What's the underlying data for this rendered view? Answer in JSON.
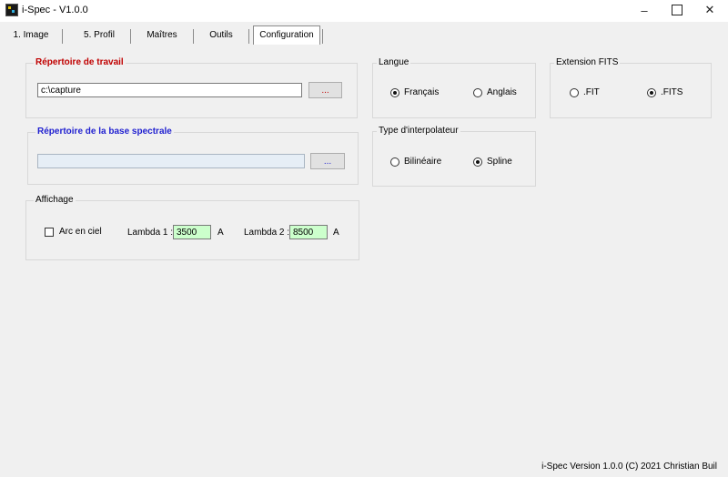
{
  "window": {
    "title": "i-Spec - V1.0.0",
    "minimize": "–",
    "close": "✕"
  },
  "tabs": [
    {
      "label": "1. Image"
    },
    {
      "label": "5. Profil"
    },
    {
      "label": "Maîtres"
    },
    {
      "label": "Outils"
    },
    {
      "label": "Configuration",
      "active": true
    }
  ],
  "workdir": {
    "legend": "Répertoire de travail",
    "value": "c:\\capture",
    "browse": "..."
  },
  "spectral_db": {
    "legend": "Répertoire de la base spectrale",
    "value": "",
    "browse": "..."
  },
  "display": {
    "legend": "Affichage",
    "rainbow_label": "Arc en ciel",
    "rainbow_checked": false,
    "lambda1_label": "Lambda 1 :",
    "lambda1_value": "3500",
    "lambda1_unit": "A",
    "lambda2_label": "Lambda 2 :",
    "lambda2_value": "8500",
    "lambda2_unit": "A"
  },
  "language": {
    "legend": "Langue",
    "options": [
      {
        "label": "Français",
        "checked": true
      },
      {
        "label": "Anglais",
        "checked": false
      }
    ]
  },
  "interpolator": {
    "legend": "Type d'interpolateur",
    "options": [
      {
        "label": "Bilinéaire",
        "checked": false
      },
      {
        "label": "Spline",
        "checked": true
      }
    ]
  },
  "fits_extension": {
    "legend": "Extension FITS",
    "options": [
      {
        "label": ".FIT",
        "checked": false
      },
      {
        "label": ".FITS",
        "checked": true
      }
    ]
  },
  "footer": {
    "version": "i-Spec Version 1.0.0 (C) 2021 Christian Buil"
  },
  "colors": {
    "workdir_legend": "#c00000",
    "spectral_legend": "#1f1fd0",
    "lambda_field_bg": "#ccffcc"
  }
}
